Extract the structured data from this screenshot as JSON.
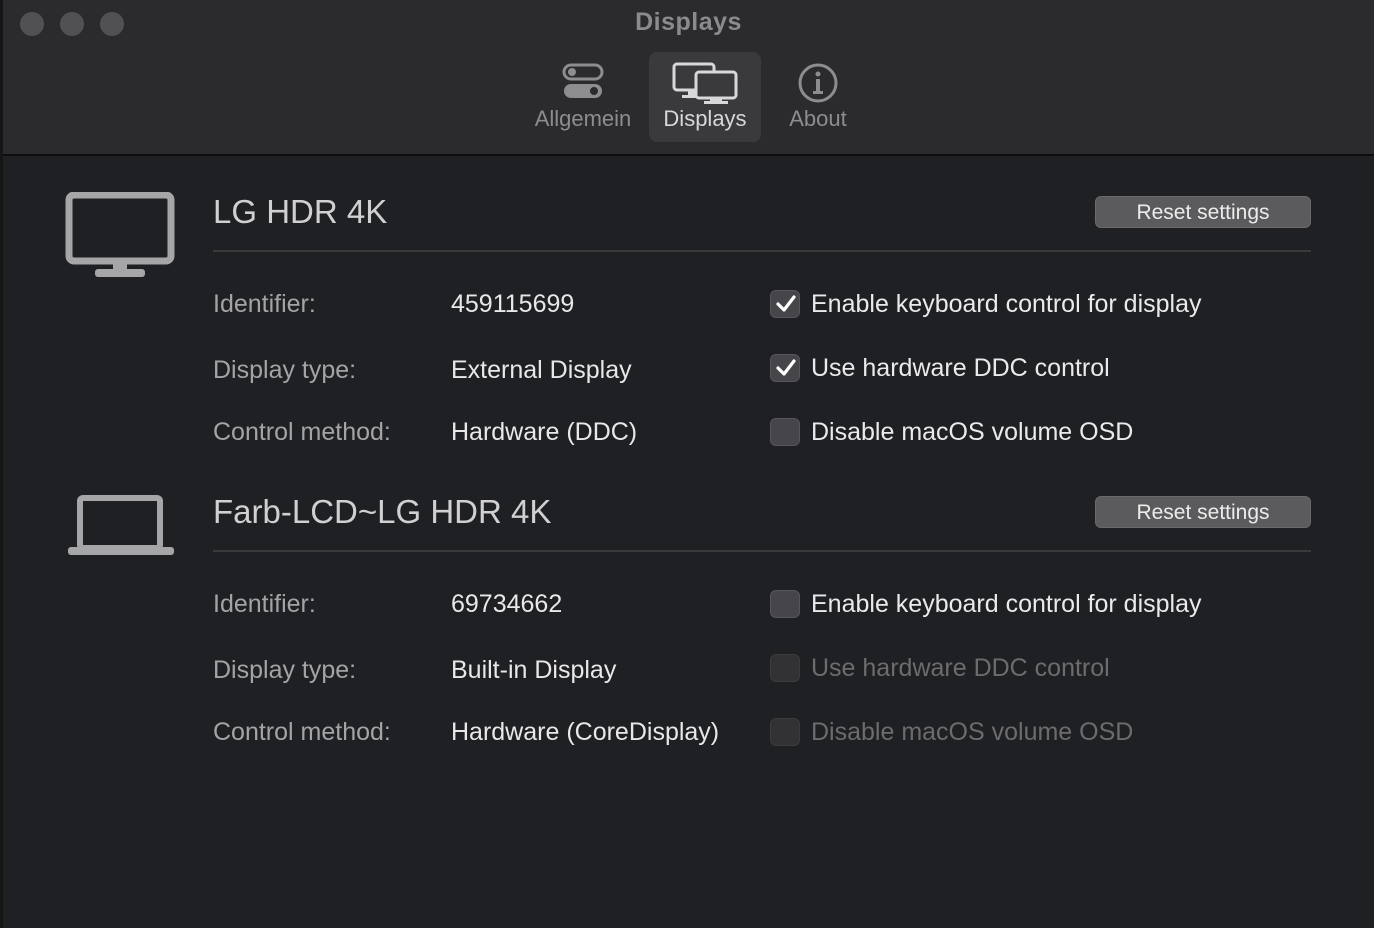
{
  "window": {
    "title": "Displays"
  },
  "tabs": [
    {
      "label": "Allgemein",
      "icon": "switches-icon",
      "active": false
    },
    {
      "label": "Displays",
      "icon": "displays-icon",
      "active": true
    },
    {
      "label": "About",
      "icon": "info-icon",
      "active": false
    }
  ],
  "displays": [
    {
      "name": "LG HDR 4K",
      "icon": "monitor-icon",
      "reset_label": "Reset settings",
      "fields": [
        {
          "label": "Identifier:",
          "value": "459115699"
        },
        {
          "label": "Display type:",
          "value": "External Display"
        },
        {
          "label": "Control method:",
          "value": "Hardware (DDC)"
        }
      ],
      "options": [
        {
          "label": "Enable keyboard control for display",
          "checked": true,
          "enabled": true
        },
        {
          "label": "Use hardware DDC control",
          "checked": true,
          "enabled": true
        },
        {
          "label": "Disable macOS volume OSD",
          "checked": false,
          "enabled": true
        }
      ]
    },
    {
      "name": "Farb-LCD~LG HDR 4K",
      "icon": "laptop-icon",
      "reset_label": "Reset settings",
      "fields": [
        {
          "label": "Identifier:",
          "value": "69734662"
        },
        {
          "label": "Display type:",
          "value": "Built-in Display"
        },
        {
          "label": "Control method:",
          "value": "Hardware (CoreDisplay)"
        }
      ],
      "options": [
        {
          "label": "Enable keyboard control for display",
          "checked": false,
          "enabled": true
        },
        {
          "label": "Use hardware DDC control",
          "checked": false,
          "enabled": false
        },
        {
          "label": "Disable macOS volume OSD",
          "checked": false,
          "enabled": false
        }
      ]
    }
  ]
}
